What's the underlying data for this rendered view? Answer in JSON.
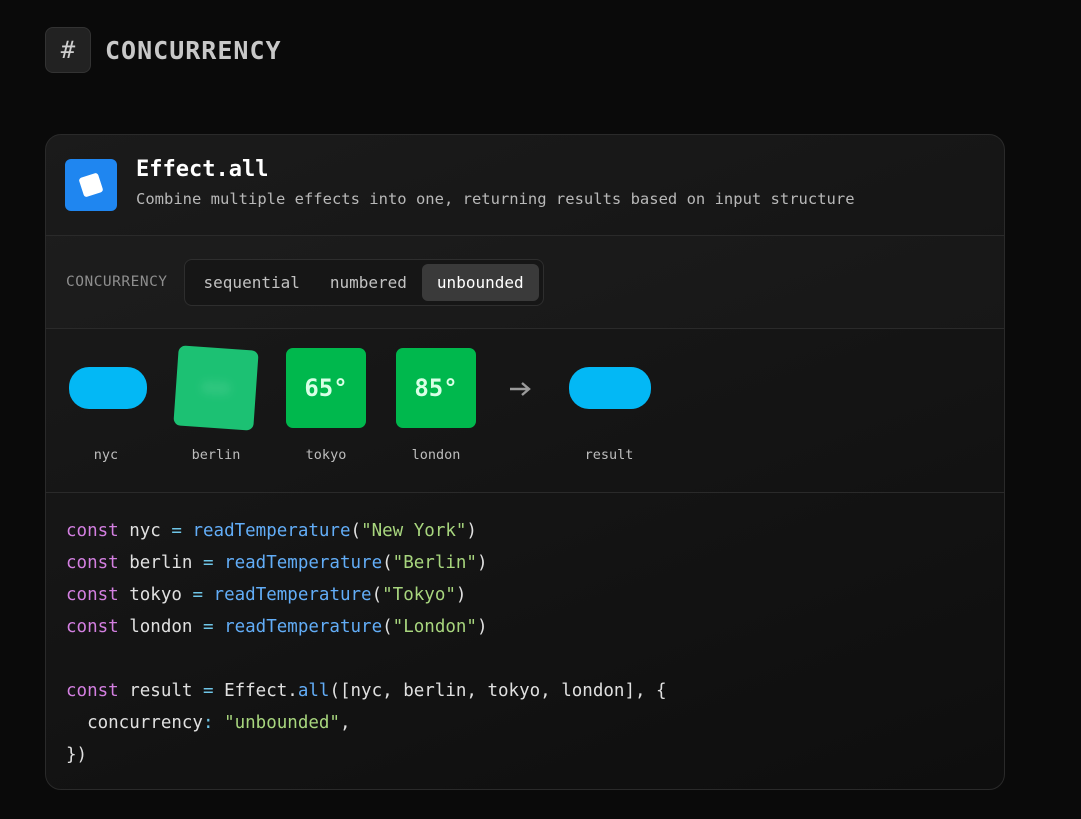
{
  "section": {
    "icon": "hash-icon",
    "title": "CONCURRENCY"
  },
  "card": {
    "icon": "cube-icon",
    "title": "Effect.all",
    "description": "Combine multiple effects into one, returning results based on input structure"
  },
  "controls": {
    "label": "CONCURRENCY",
    "options": [
      "sequential",
      "numbered",
      "unbounded"
    ],
    "selected": "unbounded"
  },
  "visualization": {
    "nodes": [
      {
        "name": "nyc",
        "state": "pending",
        "value": ""
      },
      {
        "name": "berlin",
        "state": "running",
        "value": ""
      },
      {
        "name": "tokyo",
        "state": "done",
        "value": "65°"
      },
      {
        "name": "london",
        "state": "done",
        "value": "85°"
      }
    ],
    "arrow_icon": "arrow-right-icon",
    "result": {
      "name": "result",
      "state": "pending"
    },
    "colors": {
      "pending": "#03b8f5",
      "done": "#00b84d",
      "running": "#1cc173"
    }
  },
  "code": {
    "lines": [
      [
        {
          "t": "const",
          "c": "kw"
        },
        {
          "t": " nyc "
        },
        {
          "t": "=",
          "c": "op"
        },
        {
          "t": " "
        },
        {
          "t": "readTemperature",
          "c": "fn"
        },
        {
          "t": "("
        },
        {
          "t": "\"New York\"",
          "c": "str"
        },
        {
          "t": ")"
        }
      ],
      [
        {
          "t": "const",
          "c": "kw"
        },
        {
          "t": " berlin "
        },
        {
          "t": "=",
          "c": "op"
        },
        {
          "t": " "
        },
        {
          "t": "readTemperature",
          "c": "fn"
        },
        {
          "t": "("
        },
        {
          "t": "\"Berlin\"",
          "c": "str"
        },
        {
          "t": ")"
        }
      ],
      [
        {
          "t": "const",
          "c": "kw"
        },
        {
          "t": " tokyo "
        },
        {
          "t": "=",
          "c": "op"
        },
        {
          "t": " "
        },
        {
          "t": "readTemperature",
          "c": "fn"
        },
        {
          "t": "("
        },
        {
          "t": "\"Tokyo\"",
          "c": "str"
        },
        {
          "t": ")"
        }
      ],
      [
        {
          "t": "const",
          "c": "kw"
        },
        {
          "t": " london "
        },
        {
          "t": "=",
          "c": "op"
        },
        {
          "t": " "
        },
        {
          "t": "readTemperature",
          "c": "fn"
        },
        {
          "t": "("
        },
        {
          "t": "\"London\"",
          "c": "str"
        },
        {
          "t": ")"
        }
      ],
      [],
      [
        {
          "t": "const",
          "c": "kw"
        },
        {
          "t": " result "
        },
        {
          "t": "=",
          "c": "op"
        },
        {
          "t": " Effect."
        },
        {
          "t": "all",
          "c": "fn"
        },
        {
          "t": "([nyc, berlin, tokyo, london], {"
        }
      ],
      [
        {
          "t": "  concurrency"
        },
        {
          "t": ":",
          "c": "op"
        },
        {
          "t": " "
        },
        {
          "t": "\"unbounded\"",
          "c": "str"
        },
        {
          "t": ","
        }
      ],
      [
        {
          "t": "})"
        }
      ]
    ]
  }
}
